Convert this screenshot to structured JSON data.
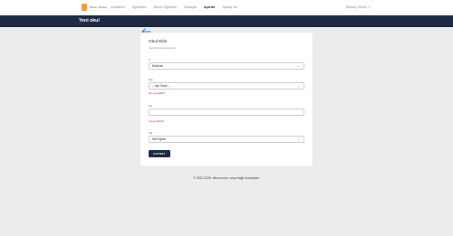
{
  "brand": {
    "name": "Bilsem Market"
  },
  "nav": {
    "items": [
      {
        "label": "Ürünlerim",
        "active": false
      },
      {
        "label": "Öğretmen",
        "active": false
      },
      {
        "label": "Benim Öğelerim",
        "active": false
      },
      {
        "label": "Mesajlar",
        "active": false
      },
      {
        "label": "Ayarlar",
        "active": true
      },
      {
        "label": "Sipariş ver",
        "active": false
      }
    ],
    "user": "Bölmey Seçim"
  },
  "page": {
    "title": "Yeni okul"
  },
  "form": {
    "title": "Okul Ekle",
    "subtitle": "Yeni bir okul oluşturun.",
    "il_label": "İl",
    "il_value": "Balıkesir",
    "ilce_label": "İlçe",
    "ilce_value": "-- İlçe Seçin --",
    "ilce_error": "İlçe gereklidir!",
    "ad_label": "Ad",
    "ad_value": "",
    "ad_error": "Ad gereklidir!",
    "tur_label": "Tür",
    "tur_value": "Milli Eğitim",
    "save_label": "KAYDET"
  },
  "footer": {
    "text": "© 2022-2025. bilsem.com, veya bağlı kuruluşları."
  },
  "colors": {
    "navy": "#1f2a44",
    "accent": "#f29d38",
    "error": "#c0392b",
    "arrow": "#2f7de1"
  }
}
